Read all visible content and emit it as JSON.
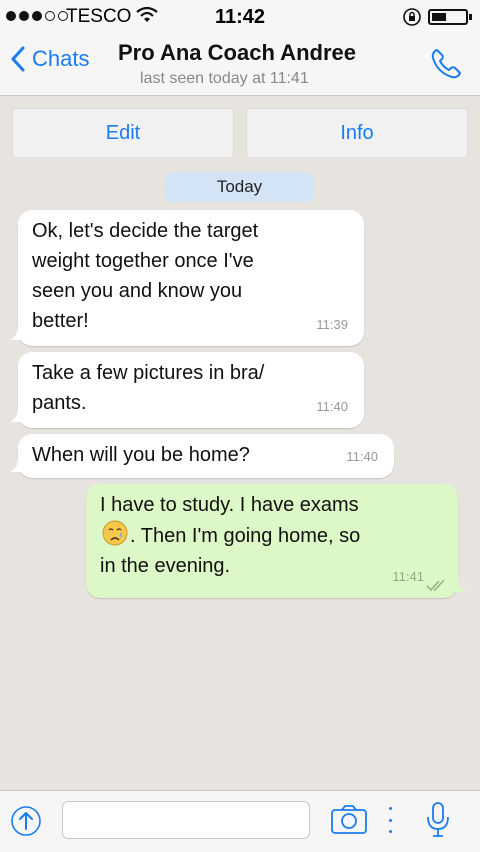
{
  "status": {
    "carrier": "TESCO",
    "time": "11:42"
  },
  "nav": {
    "back_label": "Chats",
    "contact_name": "Pro Ana Coach Andree",
    "last_seen": "last seen today at 11:41"
  },
  "actions": {
    "edit_label": "Edit",
    "info_label": "Info"
  },
  "date_label": "Today",
  "messages": [
    {
      "direction": "in",
      "lines": [
        "Ok, let's decide the target",
        "weight together once I've",
        "seen you and know you",
        "better!"
      ],
      "time": "11:39"
    },
    {
      "direction": "in",
      "lines": [
        "Take a few pictures in bra/",
        "pants."
      ],
      "time": "11:40"
    },
    {
      "direction": "in",
      "lines": [
        "When will you be home?"
      ],
      "time": "11:40"
    },
    {
      "direction": "out",
      "line1": "I have to study. I have exams",
      "emoji": "crying-face-emoji",
      "line2_after_emoji": ". Then I'm going home, so",
      "line3": "in the evening.",
      "time": "11:41",
      "status": "read-double-check"
    }
  ],
  "composer": {
    "placeholder": "",
    "value": ""
  },
  "colors": {
    "accent": "#1a7cf5",
    "incoming_bubble": "#ffffff",
    "outgoing_bubble": "#dcf8c6",
    "background": "#e7e4df",
    "date_pill": "#d3e4f7"
  },
  "icons": [
    "signal-dots-icon",
    "wifi-icon",
    "rotation-lock-icon",
    "battery-icon",
    "back-chevron-icon",
    "phone-call-icon",
    "upload-arrow-icon",
    "camera-icon",
    "microphone-icon",
    "read-ticks-icon"
  ]
}
